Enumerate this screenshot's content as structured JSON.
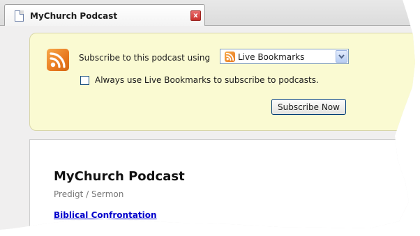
{
  "tab": {
    "title": "MyChurch Podcast",
    "close_glyph": "x"
  },
  "subscribe": {
    "label": "Subscribe to this podcast using",
    "reader_selected": "Live Bookmarks",
    "always_label": "Always use Live Bookmarks to subscribe to podcasts.",
    "always_checked": false,
    "button_label": "Subscribe Now"
  },
  "feed": {
    "title": "MyChurch Podcast",
    "subtitle": "Predigt / Sermon",
    "entry_title": "Biblical Confrontation"
  },
  "icons": {
    "tab": "document-icon",
    "close": "close-icon",
    "feed": "rss-feed-icon",
    "reader": "live-bookmarks-icon",
    "dropdown": "chevron-down-icon"
  },
  "colors": {
    "panel_background": "#fafad2",
    "rss_orange": "#e8791f",
    "link": "#0000cc",
    "close_red": "#c9302c"
  }
}
